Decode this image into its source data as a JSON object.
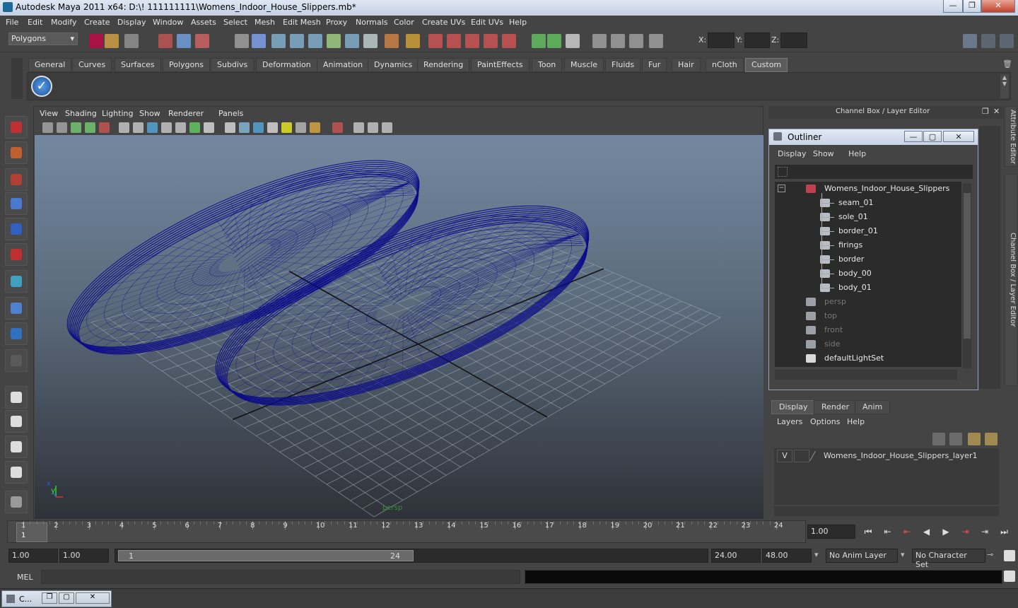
{
  "window": {
    "title": "Autodesk Maya 2011 x64: D:\\! 111111111\\Womens_Indoor_House_Slippers.mb*",
    "min_glyph": "—",
    "max_glyph": "❐",
    "close_glyph": "✕"
  },
  "menubar": [
    "File",
    "Edit",
    "Modify",
    "Create",
    "Display",
    "Window",
    "Assets",
    "Select",
    "Mesh",
    "Edit Mesh",
    "Proxy",
    "Normals",
    "Color",
    "Create UVs",
    "Edit UVs",
    "Help"
  ],
  "statusline": {
    "mode": "Polygons",
    "x_label": "X:",
    "y_label": "Y:",
    "z_label": "Z:"
  },
  "shelf_tabs": [
    "General",
    "Curves",
    "Surfaces",
    "Polygons",
    "Subdivs",
    "Deformation",
    "Animation",
    "Dynamics",
    "Rendering",
    "PaintEffects",
    "Toon",
    "Muscle",
    "Fluids",
    "Fur",
    "Hair",
    "nCloth",
    "Custom"
  ],
  "shelf_active": "Custom",
  "viewport": {
    "menu": [
      "View",
      "Shading",
      "Lighting",
      "Show",
      "Renderer",
      "Panels"
    ],
    "camera_label": "persp",
    "wire_color": "#0a0a8a",
    "axis_x": "x",
    "axis_y": "y"
  },
  "channelbox_header": "Channel Box / Layer Editor",
  "side_tabs": [
    "Attribute Editor",
    "Channel Box / Layer Editor"
  ],
  "outliner": {
    "title": "Outliner",
    "menu": [
      "Display",
      "Show",
      "Help"
    ],
    "root": "Womens_Indoor_House_Slippers",
    "children": [
      "seam_01",
      "sole_01",
      "border_01",
      "firings",
      "border",
      "body_00",
      "body_01"
    ],
    "cameras": [
      "persp",
      "top",
      "front",
      "side"
    ],
    "sets": [
      "defaultLightSet"
    ]
  },
  "layer_editor": {
    "tabs": [
      "Display",
      "Render",
      "Anim"
    ],
    "active_tab": "Display",
    "menu": [
      "Layers",
      "Options",
      "Help"
    ],
    "layer_visible": "V",
    "layer_name": "Womens_Indoor_House_Slippers_layer1"
  },
  "timeline": {
    "frames": [
      "1",
      "2",
      "3",
      "4",
      "5",
      "6",
      "7",
      "8",
      "9",
      "10",
      "11",
      "12",
      "13",
      "14",
      "15",
      "16",
      "17",
      "18",
      "19",
      "20",
      "21",
      "22",
      "23",
      "24"
    ],
    "current_frame": "1",
    "current_time": "1.00"
  },
  "range": {
    "start_time": "1.00",
    "playback_start": "1.00",
    "range_start": "1",
    "range_end": "24",
    "playback_end": "24.00",
    "end_time": "48.00",
    "anim_layer": "No Anim Layer",
    "character_set": "No Character Set"
  },
  "cmdline": {
    "label": "MEL"
  },
  "taskbar": {
    "item": "C..."
  }
}
